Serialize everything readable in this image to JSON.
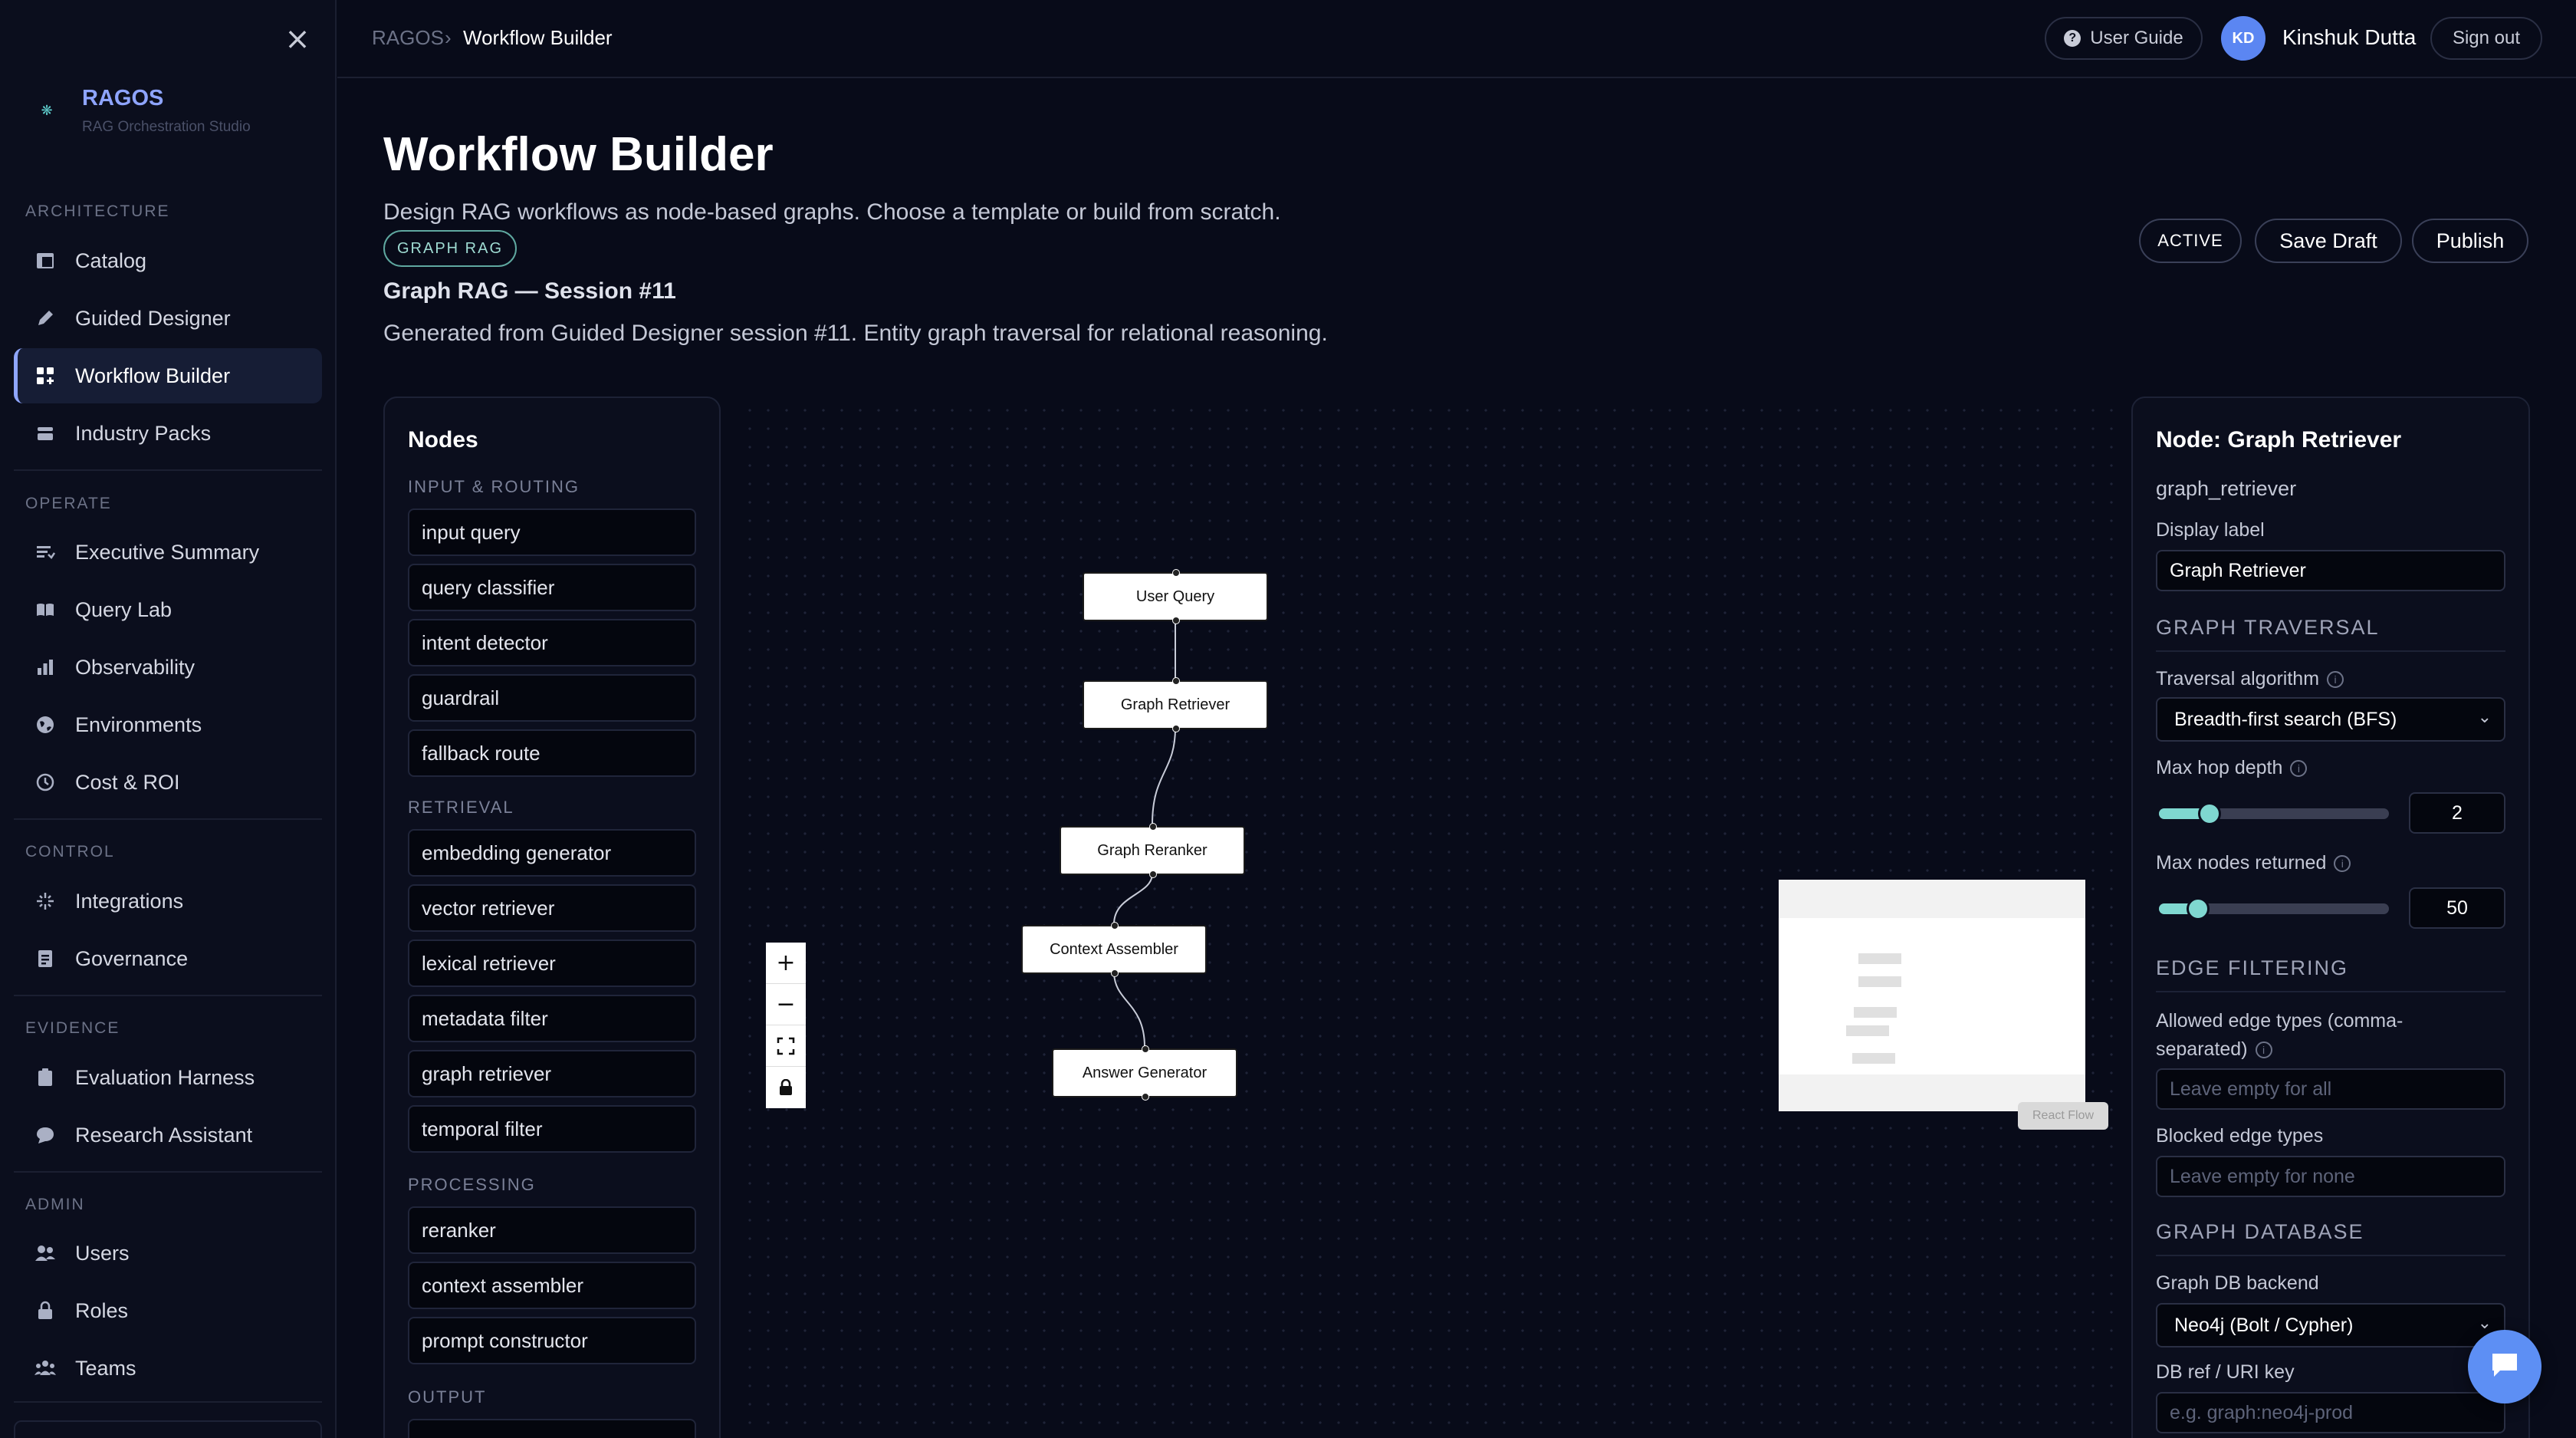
{
  "sidebar": {
    "brand": "RAGOS",
    "brand_sub": "RAG Orchestration Studio",
    "sections": {
      "architecture": "ARCHITECTURE",
      "operate": "OPERATE",
      "control": "CONTROL",
      "evidence": "EVIDENCE",
      "admin": "ADMIN"
    },
    "items": {
      "catalog": "Catalog",
      "guided_designer": "Guided Designer",
      "workflow_builder": "Workflow Builder",
      "industry_packs": "Industry Packs",
      "executive_summary": "Executive Summary",
      "query_lab": "Query Lab",
      "observability": "Observability",
      "environments": "Environments",
      "cost_roi": "Cost & ROI",
      "integrations": "Integrations",
      "governance": "Governance",
      "evaluation_harness": "Evaluation Harness",
      "research_assistant": "Research Assistant",
      "users": "Users",
      "roles": "Roles",
      "teams": "Teams"
    }
  },
  "topbar": {
    "breadcrumb_root": "RAGOS",
    "breadcrumb_sep": "›",
    "breadcrumb_current": "Workflow Builder",
    "user_guide": "User Guide",
    "avatar_initials": "KD",
    "user_name": "Kinshuk Dutta",
    "sign_out": "Sign out"
  },
  "header": {
    "title": "Workflow Builder",
    "description": "Design RAG workflows as node-based graphs. Choose a template or build from scratch.",
    "tag": "GRAPH RAG",
    "session_title": "Graph RAG — Session #11",
    "session_desc": "Generated from Guided Designer session #11. Entity graph traversal for relational reasoning.",
    "status": "ACTIVE",
    "save_draft": "Save Draft",
    "publish": "Publish"
  },
  "nodes_panel": {
    "title": "Nodes",
    "groups": {
      "input_routing": {
        "label": "INPUT & ROUTING",
        "items": [
          "input query",
          "query classifier",
          "intent detector",
          "guardrail",
          "fallback route"
        ]
      },
      "retrieval": {
        "label": "RETRIEVAL",
        "items": [
          "embedding generator",
          "vector retriever",
          "lexical retriever",
          "metadata filter",
          "graph retriever",
          "temporal filter"
        ]
      },
      "processing": {
        "label": "PROCESSING",
        "items": [
          "reranker",
          "context assembler",
          "prompt constructor"
        ]
      },
      "output": {
        "label": "OUTPUT"
      }
    }
  },
  "canvas": {
    "nodes": {
      "user_query": "User Query",
      "graph_retriever": "Graph Retriever",
      "graph_reranker": "Graph Reranker",
      "context_assembler": "Context Assembler",
      "answer_generator": "Answer Generator"
    },
    "attribution": "React Flow"
  },
  "inspector": {
    "title": "Node: Graph Retriever",
    "node_id": "graph_retriever",
    "display_label": "Display label",
    "display_value": "Graph Retriever",
    "graph_traversal": "GRAPH TRAVERSAL",
    "traversal_algorithm": "Traversal algorithm",
    "traversal_value": "Breadth-first search (BFS)",
    "max_hop_depth": "Max hop depth",
    "max_hop_value": "2",
    "max_hop_fraction": 0.22,
    "max_nodes": "Max nodes returned",
    "max_nodes_value": "50",
    "max_nodes_fraction": 0.17,
    "edge_filtering": "EDGE FILTERING",
    "allowed_edges": "Allowed edge types (comma-separated)",
    "allowed_placeholder": "Leave empty for all",
    "blocked_edges": "Blocked edge types",
    "blocked_placeholder": "Leave empty for none",
    "graph_database": "GRAPH DATABASE",
    "db_backend": "Graph DB backend",
    "db_backend_value": "Neo4j (Bolt / Cypher)",
    "db_ref": "DB ref / URI key",
    "db_ref_placeholder": "e.g. graph:neo4j-prod"
  }
}
